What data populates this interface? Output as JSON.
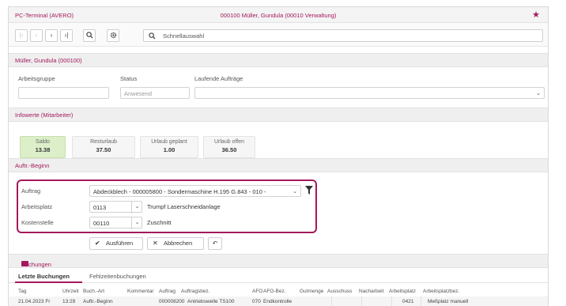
{
  "header": {
    "app_title": "PC-Terminal (AVERO)",
    "center_title": "000100  Müller, Gundula  (00010 Verwaltung)"
  },
  "toolbar": {
    "search_placeholder": "Schnellauswahl"
  },
  "employee": {
    "section_title": "Müller, Gundula (000100)",
    "group_label": "Arbeitsgruppe",
    "group_value": "",
    "status_label": "Status",
    "status_value": "Anwesend",
    "orders_label": "Laufende Aufträge",
    "orders_value": ""
  },
  "info": {
    "section_title": "Infowerte (Mitarbeiter)",
    "tiles": [
      {
        "label": "Saldo",
        "value": "13.38"
      },
      {
        "label": "Resturlaub",
        "value": "37.50"
      },
      {
        "label": "Urlaub geplant",
        "value": "1.00"
      },
      {
        "label": "Urlaub offen",
        "value": "36.50"
      }
    ]
  },
  "order_start": {
    "section_title": "Auftr.-Beginn",
    "auftrag_label": "Auftrag",
    "auftrag_value": "Abdeckblech - 000005800 - Sondermaschine H.195 G.843 - 010 -",
    "arbeitsplatz_label": "Arbeitsplatz",
    "arbeitsplatz_code": "0113",
    "arbeitsplatz_desc": "Trumpf Laserschneidanlage",
    "kostenstelle_label": "Kostenstelle",
    "kostenstelle_code": "00110",
    "kostenstelle_desc": "Zuschnitt",
    "execute_label": "Ausführen",
    "cancel_label": "Abbrechen"
  },
  "bookings": {
    "section_title": "Buchungen",
    "tabs": [
      "Letzte Buchungen",
      "Fehlzeitenbuchungen"
    ],
    "columns": [
      "Tag",
      "Uhrzeit",
      "Buch.-Art",
      "Kommentar",
      "Auftrag",
      "Auftragsbez.",
      "AFO",
      "AFO-Bez.",
      "Gutmenge",
      "Ausschuss",
      "Nacharbeit",
      "Arbeitsplatz",
      "Arbeitsplatzbez."
    ],
    "rows": [
      [
        "21.04.2023 Fr",
        "13:29",
        "Auftr.-Beginn",
        "",
        "000008200",
        "Antriebswelle TS100",
        "070",
        "Endkontrolle",
        "",
        "",
        "",
        "0421",
        "Meßplatz manuell"
      ]
    ]
  },
  "colors": {
    "accent": "#a3195b",
    "saldo_bg": "#dcefc9"
  }
}
